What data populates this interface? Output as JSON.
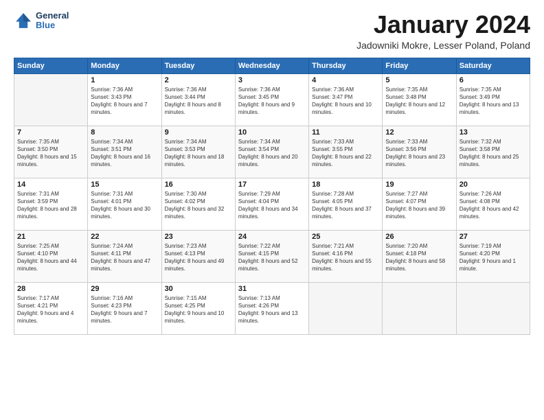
{
  "header": {
    "logo_line1": "General",
    "logo_line2": "Blue",
    "month_title": "January 2024",
    "subtitle": "Jadowniki Mokre, Lesser Poland, Poland"
  },
  "weekdays": [
    "Sunday",
    "Monday",
    "Tuesday",
    "Wednesday",
    "Thursday",
    "Friday",
    "Saturday"
  ],
  "weeks": [
    [
      {
        "day": "",
        "empty": true
      },
      {
        "day": "1",
        "sunrise": "Sunrise: 7:36 AM",
        "sunset": "Sunset: 3:43 PM",
        "daylight": "Daylight: 8 hours and 7 minutes."
      },
      {
        "day": "2",
        "sunrise": "Sunrise: 7:36 AM",
        "sunset": "Sunset: 3:44 PM",
        "daylight": "Daylight: 8 hours and 8 minutes."
      },
      {
        "day": "3",
        "sunrise": "Sunrise: 7:36 AM",
        "sunset": "Sunset: 3:45 PM",
        "daylight": "Daylight: 8 hours and 9 minutes."
      },
      {
        "day": "4",
        "sunrise": "Sunrise: 7:36 AM",
        "sunset": "Sunset: 3:47 PM",
        "daylight": "Daylight: 8 hours and 10 minutes."
      },
      {
        "day": "5",
        "sunrise": "Sunrise: 7:35 AM",
        "sunset": "Sunset: 3:48 PM",
        "daylight": "Daylight: 8 hours and 12 minutes."
      },
      {
        "day": "6",
        "sunrise": "Sunrise: 7:35 AM",
        "sunset": "Sunset: 3:49 PM",
        "daylight": "Daylight: 8 hours and 13 minutes."
      }
    ],
    [
      {
        "day": "7",
        "sunrise": "Sunrise: 7:35 AM",
        "sunset": "Sunset: 3:50 PM",
        "daylight": "Daylight: 8 hours and 15 minutes."
      },
      {
        "day": "8",
        "sunrise": "Sunrise: 7:34 AM",
        "sunset": "Sunset: 3:51 PM",
        "daylight": "Daylight: 8 hours and 16 minutes."
      },
      {
        "day": "9",
        "sunrise": "Sunrise: 7:34 AM",
        "sunset": "Sunset: 3:53 PM",
        "daylight": "Daylight: 8 hours and 18 minutes."
      },
      {
        "day": "10",
        "sunrise": "Sunrise: 7:34 AM",
        "sunset": "Sunset: 3:54 PM",
        "daylight": "Daylight: 8 hours and 20 minutes."
      },
      {
        "day": "11",
        "sunrise": "Sunrise: 7:33 AM",
        "sunset": "Sunset: 3:55 PM",
        "daylight": "Daylight: 8 hours and 22 minutes."
      },
      {
        "day": "12",
        "sunrise": "Sunrise: 7:33 AM",
        "sunset": "Sunset: 3:56 PM",
        "daylight": "Daylight: 8 hours and 23 minutes."
      },
      {
        "day": "13",
        "sunrise": "Sunrise: 7:32 AM",
        "sunset": "Sunset: 3:58 PM",
        "daylight": "Daylight: 8 hours and 25 minutes."
      }
    ],
    [
      {
        "day": "14",
        "sunrise": "Sunrise: 7:31 AM",
        "sunset": "Sunset: 3:59 PM",
        "daylight": "Daylight: 8 hours and 28 minutes."
      },
      {
        "day": "15",
        "sunrise": "Sunrise: 7:31 AM",
        "sunset": "Sunset: 4:01 PM",
        "daylight": "Daylight: 8 hours and 30 minutes."
      },
      {
        "day": "16",
        "sunrise": "Sunrise: 7:30 AM",
        "sunset": "Sunset: 4:02 PM",
        "daylight": "Daylight: 8 hours and 32 minutes."
      },
      {
        "day": "17",
        "sunrise": "Sunrise: 7:29 AM",
        "sunset": "Sunset: 4:04 PM",
        "daylight": "Daylight: 8 hours and 34 minutes."
      },
      {
        "day": "18",
        "sunrise": "Sunrise: 7:28 AM",
        "sunset": "Sunset: 4:05 PM",
        "daylight": "Daylight: 8 hours and 37 minutes."
      },
      {
        "day": "19",
        "sunrise": "Sunrise: 7:27 AM",
        "sunset": "Sunset: 4:07 PM",
        "daylight": "Daylight: 8 hours and 39 minutes."
      },
      {
        "day": "20",
        "sunrise": "Sunrise: 7:26 AM",
        "sunset": "Sunset: 4:08 PM",
        "daylight": "Daylight: 8 hours and 42 minutes."
      }
    ],
    [
      {
        "day": "21",
        "sunrise": "Sunrise: 7:25 AM",
        "sunset": "Sunset: 4:10 PM",
        "daylight": "Daylight: 8 hours and 44 minutes."
      },
      {
        "day": "22",
        "sunrise": "Sunrise: 7:24 AM",
        "sunset": "Sunset: 4:11 PM",
        "daylight": "Daylight: 8 hours and 47 minutes."
      },
      {
        "day": "23",
        "sunrise": "Sunrise: 7:23 AM",
        "sunset": "Sunset: 4:13 PM",
        "daylight": "Daylight: 8 hours and 49 minutes."
      },
      {
        "day": "24",
        "sunrise": "Sunrise: 7:22 AM",
        "sunset": "Sunset: 4:15 PM",
        "daylight": "Daylight: 8 hours and 52 minutes."
      },
      {
        "day": "25",
        "sunrise": "Sunrise: 7:21 AM",
        "sunset": "Sunset: 4:16 PM",
        "daylight": "Daylight: 8 hours and 55 minutes."
      },
      {
        "day": "26",
        "sunrise": "Sunrise: 7:20 AM",
        "sunset": "Sunset: 4:18 PM",
        "daylight": "Daylight: 8 hours and 58 minutes."
      },
      {
        "day": "27",
        "sunrise": "Sunrise: 7:19 AM",
        "sunset": "Sunset: 4:20 PM",
        "daylight": "Daylight: 9 hours and 1 minute."
      }
    ],
    [
      {
        "day": "28",
        "sunrise": "Sunrise: 7:17 AM",
        "sunset": "Sunset: 4:21 PM",
        "daylight": "Daylight: 9 hours and 4 minutes."
      },
      {
        "day": "29",
        "sunrise": "Sunrise: 7:16 AM",
        "sunset": "Sunset: 4:23 PM",
        "daylight": "Daylight: 9 hours and 7 minutes."
      },
      {
        "day": "30",
        "sunrise": "Sunrise: 7:15 AM",
        "sunset": "Sunset: 4:25 PM",
        "daylight": "Daylight: 9 hours and 10 minutes."
      },
      {
        "day": "31",
        "sunrise": "Sunrise: 7:13 AM",
        "sunset": "Sunset: 4:26 PM",
        "daylight": "Daylight: 9 hours and 13 minutes."
      },
      {
        "day": "",
        "empty": true
      },
      {
        "day": "",
        "empty": true
      },
      {
        "day": "",
        "empty": true
      }
    ]
  ]
}
